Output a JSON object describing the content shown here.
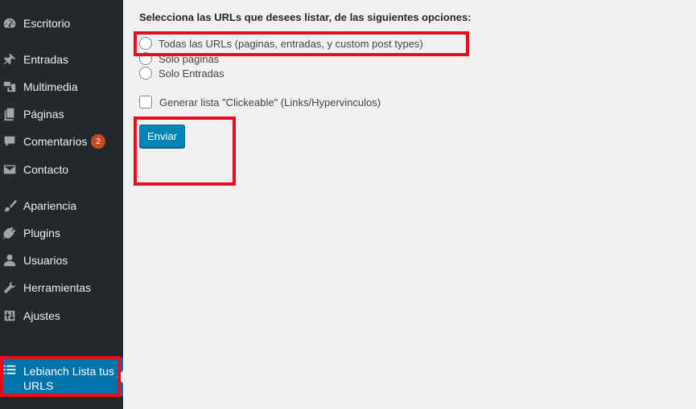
{
  "sidebar": {
    "items": [
      {
        "label": "Escritorio",
        "icon": "dashboard-icon"
      },
      {
        "label": "Entradas",
        "icon": "pin-icon"
      },
      {
        "label": "Multimedia",
        "icon": "media-icon"
      },
      {
        "label": "Páginas",
        "icon": "pages-icon"
      },
      {
        "label": "Comentarios",
        "icon": "comments-icon",
        "badge": "2"
      },
      {
        "label": "Contacto",
        "icon": "mail-icon"
      },
      {
        "label": "Apariencia",
        "icon": "brush-icon"
      },
      {
        "label": "Plugins",
        "icon": "plugin-icon"
      },
      {
        "label": "Usuarios",
        "icon": "user-icon"
      },
      {
        "label": "Herramientas",
        "icon": "wrench-icon"
      },
      {
        "label": "Ajustes",
        "icon": "settings-icon"
      }
    ],
    "active": {
      "label": "Lebianch Lista tus URLS",
      "icon": "list-icon"
    }
  },
  "main": {
    "title": "Selecciona las URLs que desees listar, de las siguientes opciones:",
    "options": [
      {
        "label": "Todas las URLs (paginas, entradas, y custom post types)"
      },
      {
        "label": "Solo paginas"
      },
      {
        "label": "Solo Entradas"
      }
    ],
    "checkbox_label": "Generar lista \"Clickeable\" (Links/Hypervinculos)",
    "submit_label": "Enviar"
  },
  "colors": {
    "sidebar_bg": "#23282d",
    "active_bg": "#0073aa",
    "button_bg": "#0085ba",
    "badge_bg": "#ca4a1f",
    "highlight": "#e0101e"
  }
}
